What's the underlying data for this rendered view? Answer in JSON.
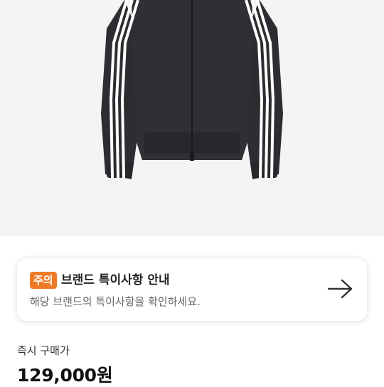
{
  "product": {
    "image_alt": "black three-stripe track jacket",
    "colors": {
      "jacket": "#2b2d31",
      "stripe": "#ffffff",
      "background": "#f4f4f4"
    }
  },
  "notice": {
    "badge": "주의",
    "title": "브랜드 특이사항 안내",
    "description": "해당 브랜드의 특이사항을 확인하세요.",
    "badge_color": "#ef7a26",
    "arrow_icon": "arrow-right-icon"
  },
  "purchase": {
    "label": "즉시 구매가",
    "price": "129,000원"
  }
}
